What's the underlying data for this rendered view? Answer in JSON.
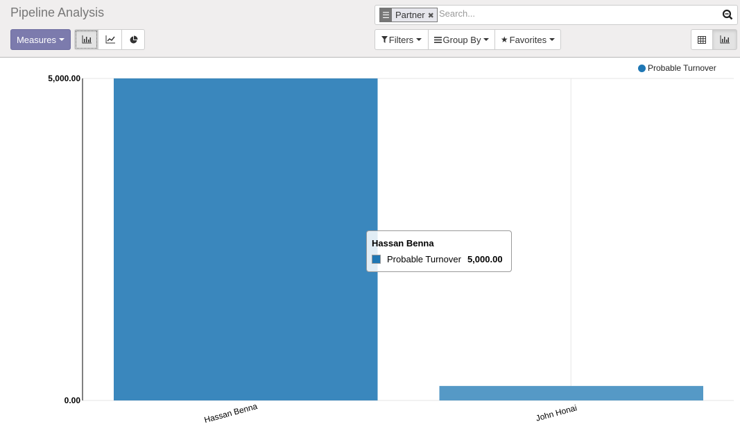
{
  "control_panel": {
    "title": "Pipeline Analysis",
    "measures_label": "Measures",
    "chart_modes": [
      {
        "name": "bar-chart",
        "active": true
      },
      {
        "name": "line-chart",
        "active": false
      },
      {
        "name": "pie-chart",
        "active": false
      }
    ],
    "search": {
      "facet_label": "Partner",
      "placeholder": "Search..."
    },
    "filters_label": "Filters",
    "groupby_label": "Group By",
    "favorites_label": "Favorites",
    "views": [
      {
        "name": "pivot",
        "active": false
      },
      {
        "name": "graph",
        "active": true
      }
    ]
  },
  "tooltip": {
    "title": "Hassan Benna",
    "series": "Probable Turnover",
    "value": "5,000.00"
  },
  "colors": {
    "bar_primary": "#3a87bd",
    "bar_secondary": "#5599c6",
    "accent": "#7c7bad"
  },
  "chart_data": {
    "type": "bar",
    "title": "",
    "xlabel": "",
    "ylabel": "",
    "categories": [
      "Hassan Benna",
      "John Honai"
    ],
    "series": [
      {
        "name": "Probable Turnover",
        "values": [
          5000,
          225
        ]
      }
    ],
    "ylim": [
      0,
      5000
    ],
    "yticks": [
      0,
      5000
    ],
    "ytick_labels": [
      "0.00",
      "5,000.00"
    ],
    "legend": "top-right",
    "grid": true
  }
}
